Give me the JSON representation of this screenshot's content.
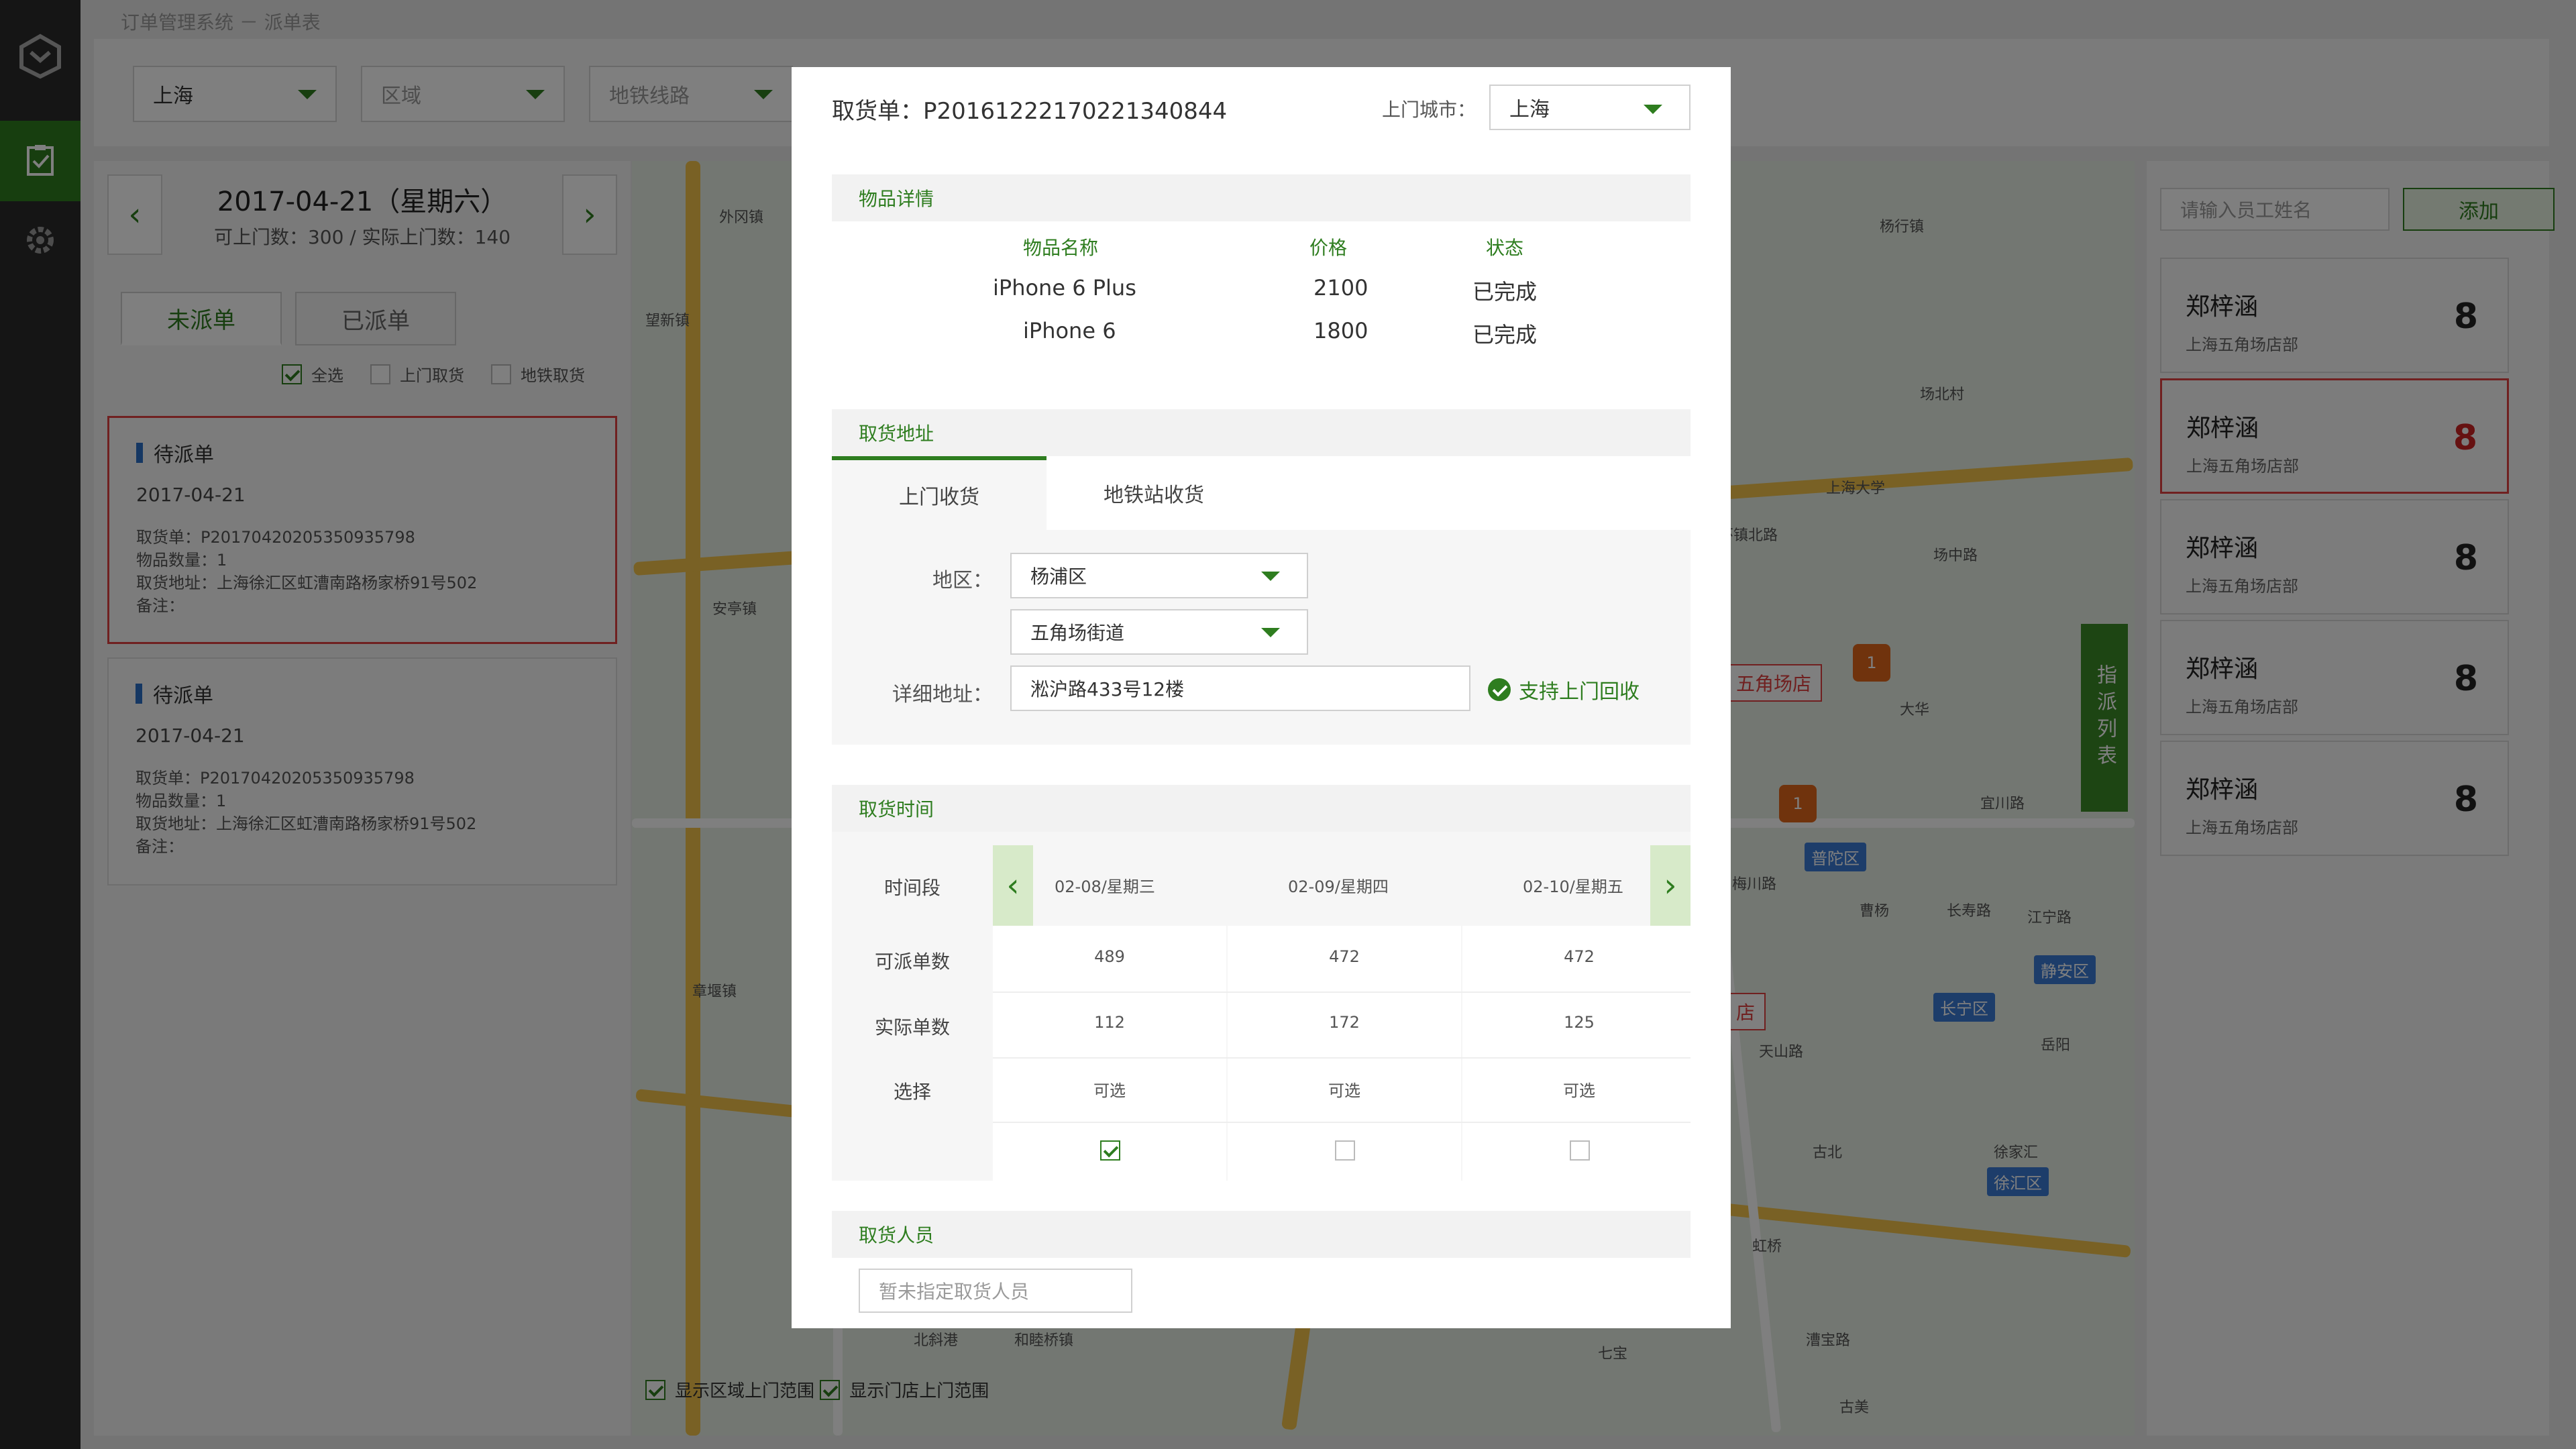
{
  "app": {
    "breadcrumb": "订单管理系统 － 派单表"
  },
  "filters": {
    "city": "上海",
    "area_placeholder": "区域",
    "metro_placeholder": "地铁线路"
  },
  "left": {
    "date": "2017-04-21（星期六）",
    "capacity": "可上门数：300 / 实际上门数：140",
    "tabs": [
      "未派单",
      "已派单"
    ],
    "checks": [
      "全选",
      "上门取货",
      "地铁取货"
    ],
    "orders": [
      {
        "status": "待派单",
        "date": "2017-04-21",
        "order_no": "取货单：P20170420205350935798",
        "qty": "物品数量：1",
        "address": "取货地址：上海徐汇区虹漕南路杨家桥91号502",
        "note": "备注："
      },
      {
        "status": "待派单",
        "date": "2017-04-21",
        "order_no": "取货单：P20170420205350935798",
        "qty": "物品数量：1",
        "address": "取货地址：上海徐汇区虹漕南路杨家桥91号502",
        "note": "备注："
      }
    ]
  },
  "map": {
    "shop_label": "五角场店",
    "shop_label2": "店",
    "pins": [
      "1",
      "1"
    ],
    "stations": [
      "普陀区",
      "长宁区",
      "静安区",
      "徐汇区"
    ],
    "side_label": "指派列表",
    "foot": [
      "显示区域上门范围",
      "显示门店上门范围"
    ],
    "labels": [
      "外冈镇",
      "望新镇",
      "安亭镇",
      "章堰镇",
      "杨行镇",
      "场北村",
      "大华",
      "江宁路",
      "曹杨",
      "长寿路",
      "宜川路",
      "上海大学",
      "环镇北路",
      "场中路",
      "梅川路",
      "天山路",
      "古北",
      "岳阳",
      "虹桥",
      "徐家汇",
      "七宝",
      "漕宝路",
      "古美",
      "和睦桥镇",
      "北斜港"
    ]
  },
  "right": {
    "search_placeholder": "请输入员工姓名",
    "add_label": "添加",
    "staff": [
      {
        "name": "郑梓涵",
        "store": "上海五角场店部",
        "count": "8"
      },
      {
        "name": "郑梓涵",
        "store": "上海五角场店部",
        "count": "8"
      },
      {
        "name": "郑梓涵",
        "store": "上海五角场店部",
        "count": "8"
      },
      {
        "name": "郑梓涵",
        "store": "上海五角场店部",
        "count": "8"
      },
      {
        "name": "郑梓涵",
        "store": "上海五角场店部",
        "count": "8"
      }
    ]
  },
  "modal": {
    "title": "取货单：P20161222170221340844",
    "city_label": "上门城市：",
    "city_value": "上海",
    "items": {
      "section": "物品详情",
      "headers": [
        "物品名称",
        "价格",
        "状态"
      ],
      "rows": [
        {
          "name": "iPhone 6 Plus",
          "price": "2100",
          "status": "已完成"
        },
        {
          "name": "iPhone 6",
          "price": "1800",
          "status": "已完成"
        }
      ]
    },
    "address": {
      "section": "取货地址",
      "tabs": [
        "上门收货",
        "地铁站收货"
      ],
      "region_label": "地区：",
      "district": "杨浦区",
      "street": "五角场街道",
      "detail_label": "详细地址：",
      "detail_value": "淞沪路433号12楼",
      "support": "支持上门回收"
    },
    "time": {
      "section": "取货时间",
      "row_labels": [
        "时间段",
        "可派单数",
        "实际单数",
        "选择"
      ],
      "days": [
        {
          "label": "02-08/星期三",
          "available": "489",
          "actual": "112",
          "select": "可选",
          "checked": true
        },
        {
          "label": "02-09/星期四",
          "available": "472",
          "actual": "172",
          "select": "可选",
          "checked": false
        },
        {
          "label": "02-10/星期五",
          "available": "472",
          "actual": "125",
          "select": "可选",
          "checked": false
        }
      ]
    },
    "person": {
      "section": "取货人员",
      "placeholder": "暂未指定取货人员"
    }
  },
  "colors": {
    "accent": "#2e7d1f",
    "alert": "#e04040",
    "nav_bg": "#2b2b2b"
  }
}
